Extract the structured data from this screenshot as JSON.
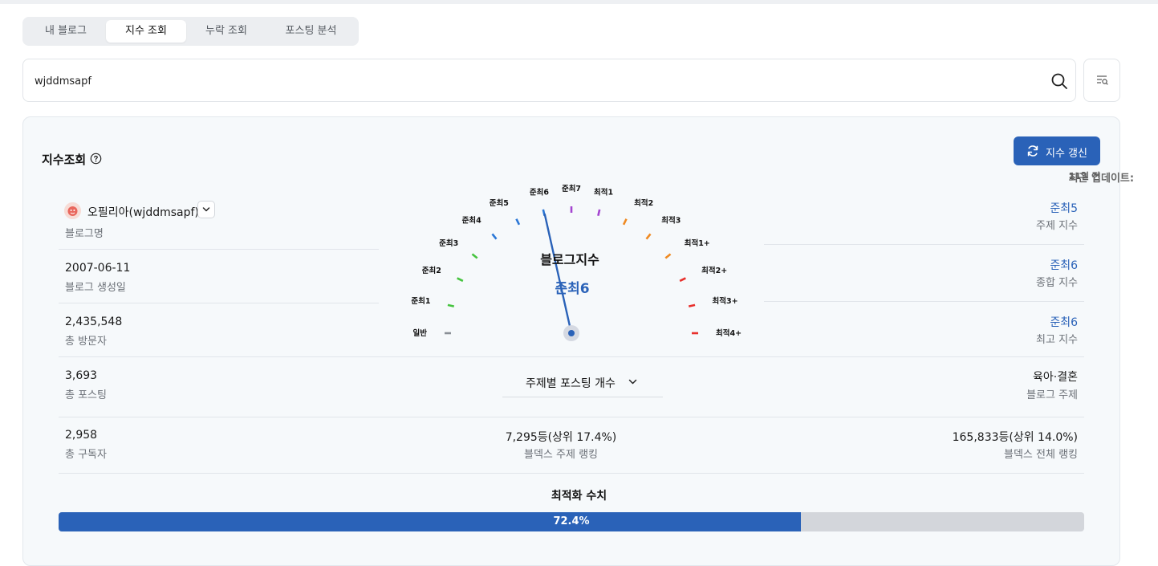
{
  "tabs": [
    "내 블로그",
    "지수 조회",
    "누락 조회",
    "포스팅 분석"
  ],
  "active_tab": 1,
  "search": {
    "value": "wjddmsapf",
    "placeholder": ""
  },
  "panel": {
    "title": "지수조회",
    "refresh_label": "지수 갱신",
    "update_label": "최근 업데이트:",
    "update_value": "11일 전"
  },
  "blog": {
    "name": "오필리아(wjddmsapf)",
    "name_label": "블로그명",
    "created": "2007-06-11",
    "created_label": "블로그 생성일",
    "visitors": "2,435,548",
    "visitors_label": "총 방문자",
    "posts": "3,693",
    "posts_label": "총 포스팅",
    "subscribers": "2,958",
    "subscribers_label": "총 구독자"
  },
  "gauge": {
    "title": "블로그지수",
    "value": "준최6",
    "levels": [
      "일반",
      "준최1",
      "준최2",
      "준최3",
      "준최4",
      "준최5",
      "준최6",
      "준최7",
      "최적1",
      "최적2",
      "최적3",
      "최적1+",
      "최적2+",
      "최적3+",
      "최적4+"
    ],
    "current_index": 6,
    "colors": [
      "#8a8f96",
      "#46c43f",
      "#46c43f",
      "#46c43f",
      "#2b77d6",
      "#2b77d6",
      "#2b77d6",
      "#a445d0",
      "#a445d0",
      "#ef8a22",
      "#ef8a22",
      "#ef8a22",
      "#e8302c",
      "#e8302c",
      "#e8302c"
    ]
  },
  "indices": {
    "topic_value": "준최5",
    "topic_label": "주제 지수",
    "overall_value": "준최6",
    "overall_label": "종합 지수",
    "max_value": "준최6",
    "max_label": "최고 지수",
    "blog_topic": "육아·결혼",
    "blog_topic_label": "블로그 주제",
    "total_rank": "165,833등(상위 14.0%)",
    "total_rank_label": "블덱스 전체 랭킹"
  },
  "topic_posts_select": "주제별 포스팅 개수",
  "topic_rank": "7,295등(상위 17.4%)",
  "topic_rank_label": "블덱스 주제 랭킹",
  "optimization": {
    "title": "최적화 수치",
    "percent": 72.4,
    "label": "72.4%"
  },
  "colors": {
    "accent": "#2a62b8"
  }
}
